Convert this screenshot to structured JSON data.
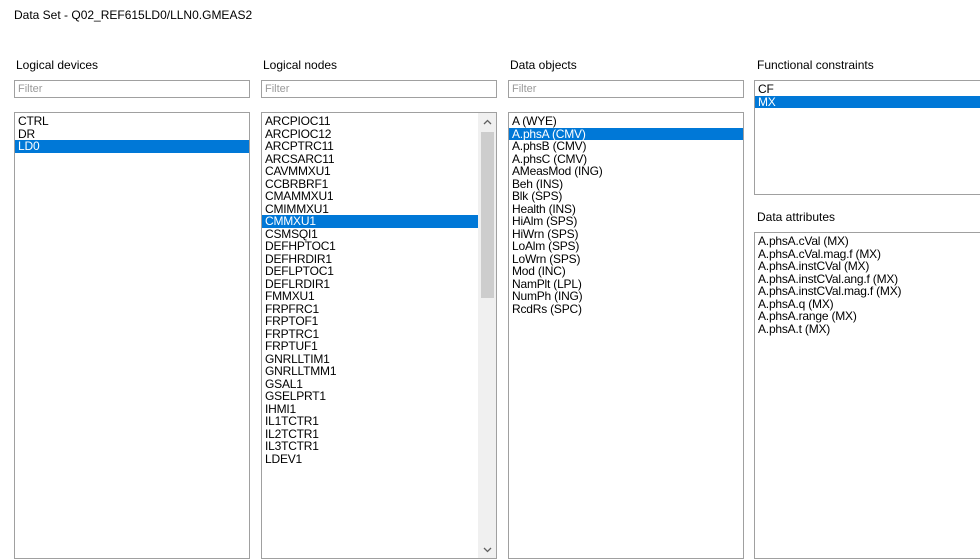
{
  "window": {
    "title": "Data Set - Q02_REF615LD0/LLN0.GMEAS2"
  },
  "logical_devices": {
    "label": "Logical devices",
    "filter_placeholder": "Filter",
    "items": [
      "CTRL",
      "DR",
      "LD0"
    ],
    "selected_index": 2
  },
  "logical_nodes": {
    "label": "Logical nodes",
    "filter_placeholder": "Filter",
    "items": [
      "ARCPIOC11",
      "ARCPIOC12",
      "ARCPTRC11",
      "ARCSARC11",
      "CAVMMXU1",
      "CCBRBRF1",
      "CMAMMXU1",
      "CMIMMXU1",
      "CMMXU1",
      "CSMSQI1",
      "DEFHPTOC1",
      "DEFHRDIR1",
      "DEFLPTOC1",
      "DEFLRDIR1",
      "FMMXU1",
      "FRPFRC1",
      "FRPTOF1",
      "FRPTRC1",
      "FRPTUF1",
      "GNRLLTIM1",
      "GNRLLTMM1",
      "GSAL1",
      "GSELPRT1",
      "IHMI1",
      "IL1TCTR1",
      "IL2TCTR1",
      "IL3TCTR1",
      "LDEV1"
    ],
    "selected_index": 8,
    "scroll_up_icon": "chevron-up-icon",
    "scroll_down_icon": "chevron-down-icon"
  },
  "data_objects": {
    "label": "Data objects",
    "filter_placeholder": "Filter",
    "items": [
      "A (WYE)",
      "A.phsA (CMV)",
      "A.phsB (CMV)",
      "A.phsC (CMV)",
      "AMeasMod (ING)",
      "Beh (INS)",
      "Blk (SPS)",
      "Health (INS)",
      "HiAlm (SPS)",
      "HiWrn (SPS)",
      "LoAlm (SPS)",
      "LoWrn (SPS)",
      "Mod (INC)",
      "NamPlt (LPL)",
      "NumPh (ING)",
      "RcdRs (SPC)"
    ],
    "selected_index": 1
  },
  "functional_constraints": {
    "label": "Functional constraints",
    "items": [
      "CF",
      "MX"
    ],
    "selected_index": 1
  },
  "data_attributes": {
    "label": "Data attributes",
    "items": [
      "A.phsA.cVal (MX)",
      "A.phsA.cVal.mag.f (MX)",
      "A.phsA.instCVal (MX)",
      "A.phsA.instCVal.ang.f (MX)",
      "A.phsA.instCVal.mag.f (MX)",
      "A.phsA.q (MX)",
      "A.phsA.range (MX)",
      "A.phsA.t (MX)"
    ]
  },
  "colors": {
    "selection": "#0078d7",
    "border": "#a0a0a0",
    "scrollbar": "#f0f0f0",
    "thumb": "#cdcdcd"
  }
}
